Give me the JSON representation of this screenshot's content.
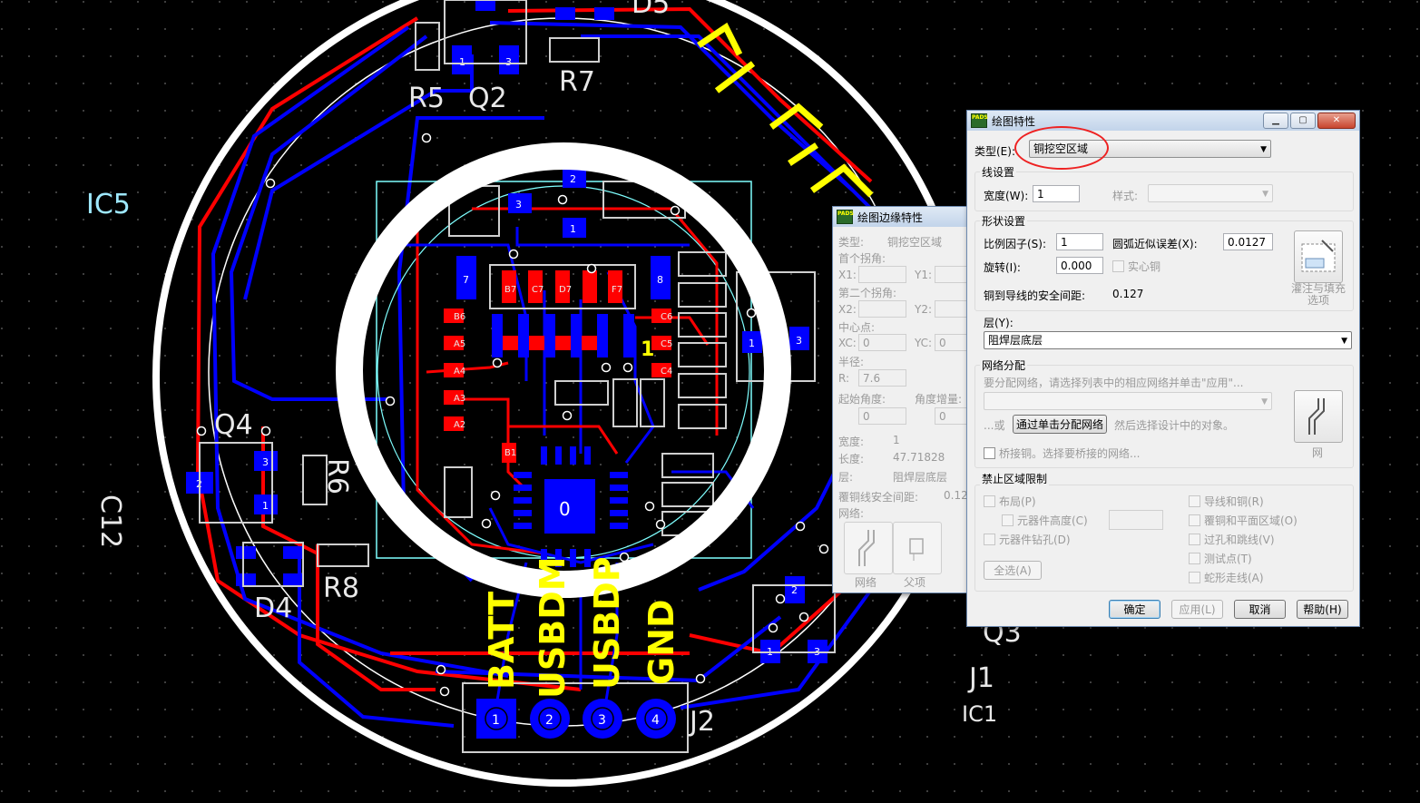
{
  "pcb": {
    "labels": {
      "ic5": "IC5",
      "c12": "C12",
      "q4": "Q4",
      "r6": "R6",
      "r8": "R8",
      "d4": "D4",
      "r5": "R5",
      "q2": "Q2",
      "r7": "R7",
      "d5": "D5",
      "q3": "Q3",
      "j1": "J1",
      "ic1": "IC1",
      "j2": "J2",
      "one": "1"
    },
    "yellow_labels": [
      "BATT",
      "USBDM",
      "USBDP",
      "GND"
    ],
    "connector_pins": [
      "1",
      "2",
      "3",
      "4"
    ],
    "chip_label": "0",
    "chip_pins": {
      "b7": "B7",
      "c7": "C7",
      "d7": "D7",
      "f7": "F7",
      "b6": "B6",
      "a5": "A5",
      "a4": "A4",
      "a3": "A3",
      "a2": "A2",
      "c6": "C6",
      "c5": "C5",
      "c4": "C4",
      "b1": "B1",
      "a7": "7",
      "b8": "8"
    },
    "colors": {
      "top_trace": "#ff0000",
      "bottom_trace": "#0000ff",
      "outline": "#ffffff",
      "silk": "#ffff00",
      "cyan": "#7fffff"
    }
  },
  "edge_dialog": {
    "title": "绘图边缘特性",
    "type_label": "类型:",
    "type_value": "铜挖空区域",
    "first_corner": "首个拐角:",
    "x1": "X1:",
    "y1": "Y1:",
    "second_corner": "第二个拐角:",
    "x2": "X2:",
    "y2": "Y2:",
    "center": "中心点:",
    "xc": "XC:",
    "xc_value": "0",
    "yc": "YC:",
    "yc_value": "0",
    "radius": "半径:",
    "r": "R:",
    "r_value": "7.6",
    "start_angle": "起始角度:",
    "start_value": "0",
    "angle_inc": "角度增量:",
    "inc_value": "0",
    "width_label": "宽度:",
    "width_value": "1",
    "length_label": "长度:",
    "length_value": "47.71828",
    "layer_label": "层:",
    "layer_value": "阻焊层底层",
    "clearance_label": "覆铜线安全间距:",
    "clearance_value": "0.127",
    "net_label": "网络:",
    "btn_net": "网络",
    "btn_parent": "父项"
  },
  "main_dialog": {
    "title": "绘图特性",
    "type_label": "类型(E):",
    "type_value": "铜挖空区域",
    "line_group": "线设置",
    "width_label": "宽度(W):",
    "width_value": "1",
    "style_label": "样式:",
    "shape_group": "形状设置",
    "scale_label": "比例因子(S):",
    "scale_value": "1",
    "arc_label": "圆弧近似误差(X):",
    "arc_value": "0.0127",
    "rotate_label": "旋转(I):",
    "rotate_value": "0.000",
    "solid_label": "实心铜",
    "clearance_label": "铜到导线的安全间距:",
    "clearance_value": "0.127",
    "pour_btn": "灌注与填充选项",
    "layer_label": "层(Y):",
    "layer_value": "阻焊层底层",
    "net_group": "网络分配",
    "net_hint": "要分配网络，请选择列表中的相应网络并单击\"应用\"...",
    "or_label": "...或",
    "assign_btn": "通过单击分配网络",
    "assign_hint": "然后选择设计中的对象。",
    "bridge_label": "桥接铜。选择要桥接的网络...",
    "net_btn": "网",
    "keepout_group": "禁止区域限制",
    "placement": "布局(P)",
    "comp_height": "元器件高度(C)",
    "comp_drill": "元器件钻孔(D)",
    "traces_copper": "导线和铜(R)",
    "copper_plane": "覆铜和平面区域(O)",
    "vias": "过孔和跳线(V)",
    "test_points": "测试点(T)",
    "serpentine": "蛇形走线(A)",
    "select_all": "全选(A)",
    "ok": "确定",
    "apply": "应用(L)",
    "cancel": "取消",
    "help": "帮助(H)"
  }
}
